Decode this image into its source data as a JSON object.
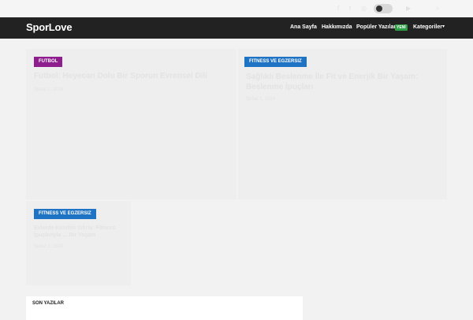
{
  "header": {
    "logo": "SporLove",
    "nav": [
      {
        "label": "Ana Sayfa"
      },
      {
        "label": "Hakkımızda"
      },
      {
        "label": "Popüler Yazılar",
        "badge": "YENİ"
      },
      {
        "label": "Kategoriler"
      }
    ]
  },
  "topbar": {
    "social_icons": [
      "facebook-icon",
      "twitter-icon",
      "instagram-icon",
      "youtube-icon",
      "search-icon"
    ]
  },
  "cards": [
    {
      "category": "FUTBOL",
      "category_color": "#8e1d8e",
      "title": "Futbol: Heyecan Dolu Bir Sporun Evrensel Dili",
      "date": "Şubat 1, 2024"
    },
    {
      "category": "FITNESS VE EGZERSIZ",
      "category_color": "#1f73c4",
      "title": "Sağlıklı Beslenme İle Fit ve Enerjik Bir Yaşam: Beslenme İpuçları",
      "date": "Şubat 1, 2024"
    },
    {
      "category": "FITNESS VE EGZERSIZ",
      "category_color": "#1f73c4",
      "title": "Evlerde Kendini Sıfırla: Fitness İpuçlarıyla ... Bir Yaşam",
      "date": "Şubat 1, 2024"
    }
  ],
  "recent": {
    "title": "SON YAZILAR"
  }
}
